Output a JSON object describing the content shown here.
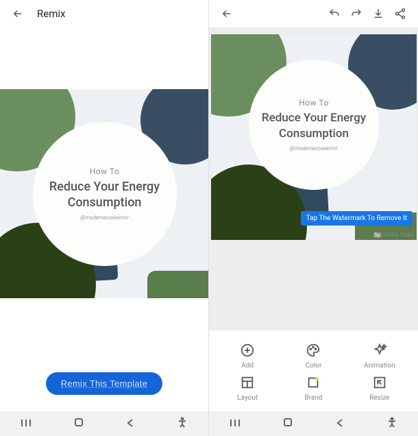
{
  "left": {
    "title": "Remix",
    "template": {
      "eyebrow": "How To",
      "headline": "Reduce Your Energy Consumption",
      "handle": "@modernecowarrior"
    },
    "cta": "Remix This Template"
  },
  "right": {
    "toolbar": {
      "undo": "undo",
      "redo": "redo",
      "download": "download",
      "share": "share"
    },
    "template": {
      "eyebrow": "How To",
      "headline": "Reduce Your Energy Consumption",
      "handle": "@modernecowarrior"
    },
    "tooltip": "Tap The Watermark To Remove It",
    "watermark": "Adobe Spark",
    "tools": {
      "add": "Add",
      "color": "Color",
      "animation": "Animation",
      "layout": "Layout",
      "brand": "Brand",
      "resize": "Resize"
    }
  },
  "colors": {
    "accent": "#1565d8",
    "tooltip": "#1976e8"
  }
}
